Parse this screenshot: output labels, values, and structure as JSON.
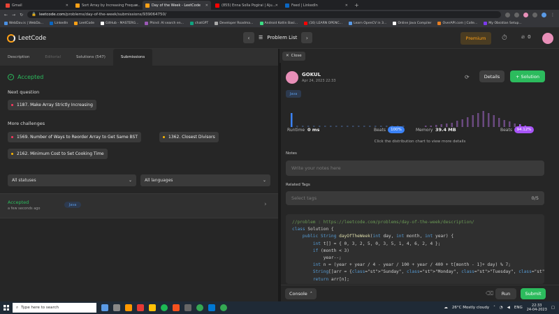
{
  "browser": {
    "tabs": [
      {
        "title": "Gmail",
        "color": "#ea4335",
        "active": false
      },
      {
        "title": "Sort Array by Increasing Freque...",
        "color": "#ffa116",
        "active": false
      },
      {
        "title": "Day of the Week - LeetCode",
        "color": "#ffa116",
        "active": true
      },
      {
        "title": "(855) Enna Solla Pogirai | Aju...",
        "color": "#ff0000",
        "active": false
      },
      {
        "title": "Feed | LinkedIn",
        "color": "#0a66c2",
        "active": false
      }
    ],
    "url_host": "leetcode.com",
    "url_path": "/problems/day-of-the-week/submissions/939064750/",
    "bookmarks": [
      {
        "label": "WebDav.is | WebDa...",
        "color": "#4a90e2"
      },
      {
        "label": "LinkedIn",
        "color": "#0a66c2"
      },
      {
        "label": "LeetCode",
        "color": "#ffa116"
      },
      {
        "label": "GitHub - MASTERG...",
        "color": "#ffffff"
      },
      {
        "label": "Phind: AI search en...",
        "color": "#9b59b6"
      },
      {
        "label": "chatGPT",
        "color": "#10a37f"
      },
      {
        "label": "Developer Roadma...",
        "color": "#aaaaaa"
      },
      {
        "label": "Android Kotlin Basi...",
        "color": "#3ddc84"
      },
      {
        "label": "(16) LEARN OPENC...",
        "color": "#ff0000"
      },
      {
        "label": "Learn OpenCV in 3...",
        "color": "#5a9ae6"
      },
      {
        "label": "Online Java Compiler",
        "color": "#ffffff"
      },
      {
        "label": "OverAPI.com | Colle...",
        "color": "#e67e22"
      },
      {
        "label": "My Obsidian Setup...",
        "color": "#7c3aed"
      }
    ]
  },
  "header": {
    "logo": "LeetCode",
    "problem_list": "Problem List",
    "premium": "Premium",
    "streak": "0"
  },
  "left": {
    "tabs": [
      "Description",
      "Editorial",
      "Solutions (547)",
      "Submissions"
    ],
    "status": "Accepted",
    "next_label": "Next question",
    "next_item": "1187. Make Array Strictly Increasing",
    "more_label": "More challenges",
    "challenges": [
      "1569. Number of Ways to Reorder Array to Get Same BST",
      "1362. Closest Divisors",
      "2162. Minimum Cost to Set Cooking Time"
    ],
    "filter_status": "All statuses",
    "filter_lang": "All languages",
    "submission": {
      "status": "Accepted",
      "when": "a few seconds ago",
      "lang": "Java"
    }
  },
  "right": {
    "close": "Close",
    "user": "GOKUL",
    "date": "Apr 24, 2023 22:33",
    "details": "Details",
    "solution": "Solution",
    "lang": "Java",
    "runtime_label": "Runtime",
    "runtime_value": "0 ms",
    "beats_label": "Beats",
    "runtime_beats": "100%",
    "memory_label": "Memory",
    "memory_value": "39.4 MB",
    "memory_beats": "94.12%",
    "hint": "Click the distribution chart to view more details",
    "notes_label": "Notes",
    "notes_placeholder": "Write your notes here",
    "tags_label": "Related Tags",
    "tags_placeholder": "Select tags",
    "tags_count": "0/5",
    "code_lines": [
      "//problem : https://leetcode.com/problems/day-of-the-week/description/",
      "class Solution {",
      "    public String dayOfTheWeek(int day, int month, int year) {",
      "        int t[] = { 0, 3, 2, 5, 0, 3, 5, 1, 4, 6, 2, 4 };",
      "        if (month < 3)",
      "            year--;",
      "        int n = (year + year / 4 - year / 100 + year / 400 + t[month - 1]+ day) % 7;",
      "        String[]arr = {\"Sunday\", \"Monday\", \"Tuesday\", \"Wednesday\", \"Thursday\", \"Friday\"",
      "        return arr[n];"
    ],
    "console": "Console",
    "run": "Run",
    "submit": "Submit"
  },
  "taskbar": {
    "search": "Type here to search",
    "weather": "26°C  Mostly cloudy",
    "lang": "ENG",
    "time": "22:33",
    "date": "24-04-2023"
  },
  "colors": {
    "accent": "#ffa116",
    "success": "#2cbb5d",
    "runtime_bar": "#3b82f6",
    "memory_bar": "#a855f7"
  }
}
